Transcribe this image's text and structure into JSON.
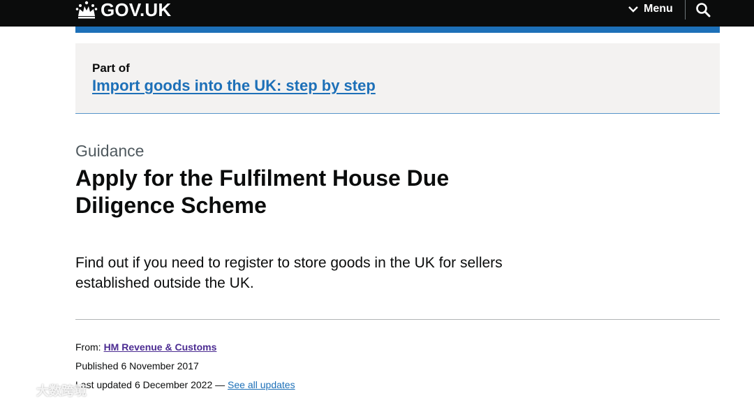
{
  "header": {
    "logo_text": "GOV.UK",
    "menu_label": "Menu",
    "background": "#0b0c0c",
    "accent_bar": "#1d70b8"
  },
  "step_nav": {
    "part_of_label": "Part of",
    "link_text": "Import goods into the UK: step by step"
  },
  "page": {
    "caption": "Guidance",
    "title": "Apply for the Fulfilment House Due Diligence Scheme",
    "lead": "Find out if you need to register to store goods in the UK for sellers established outside the UK."
  },
  "metadata": {
    "from_label": "From:",
    "organisation": "HM Revenue & Customs",
    "published_label": "Published",
    "published_date": "6 November 2017",
    "updated_label": "Last updated",
    "updated_date": "6 December 2022 —",
    "see_all_updates": "See all updates"
  },
  "watermark": {
    "text": "大数跨境"
  },
  "icons": {
    "logo": "crown-icon",
    "menu": "chevron-down-icon",
    "search": "search-icon"
  },
  "colors": {
    "link": "#1d70b8",
    "organisation_link": "#4c2c92",
    "secondary_text": "#505a5f"
  }
}
